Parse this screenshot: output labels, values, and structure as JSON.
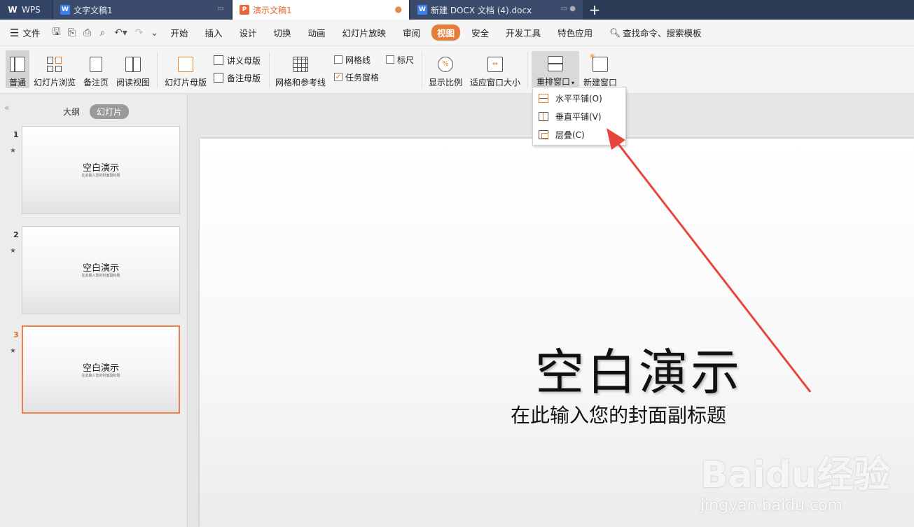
{
  "tabs": [
    {
      "label": "WPS",
      "icon": "wps-logo-icon"
    },
    {
      "label": "文字文稿1",
      "icon": "writer-doc-icon"
    },
    {
      "label": "演示文稿1",
      "icon": "presentation-doc-icon"
    },
    {
      "label": "新建 DOCX 文档 (4).docx",
      "icon": "writer-doc-icon"
    }
  ],
  "menu": {
    "file": "文件",
    "items": [
      "开始",
      "插入",
      "设计",
      "切换",
      "动画",
      "幻灯片放映",
      "审阅",
      "视图",
      "安全",
      "开发工具",
      "特色应用"
    ],
    "active": "视图",
    "search": "查找命令、搜索模板"
  },
  "ribbon": {
    "normal": "普通",
    "slide_sorter": "幻灯片浏览",
    "notes_page": "备注页",
    "reading_view": "阅读视图",
    "slide_master": "幻灯片母版",
    "handout_master": "讲义母版",
    "notes_master": "备注母版",
    "grid_guides": "网格和参考线",
    "gridlines": "网格线",
    "ruler": "标尺",
    "task_pane": "任务窗格",
    "zoom": "显示比例",
    "fit_window": "适应窗口大小",
    "arrange": "重排窗口",
    "new_window": "新建窗口"
  },
  "arrange_menu": [
    "水平平铺(O)",
    "垂直平铺(V)",
    "层叠(C)"
  ],
  "panel": {
    "outline": "大纲",
    "slides": "幻灯片"
  },
  "slides": [
    {
      "num": "1",
      "title": "空白演示",
      "subtitle": "在此输入您的封面副标题"
    },
    {
      "num": "2",
      "title": "空白演示",
      "subtitle": "在此输入您的封面副标题"
    },
    {
      "num": "3",
      "title": "空白演示",
      "subtitle": "在此输入您的封面副标题"
    }
  ],
  "current_slide": {
    "title": "空白演示",
    "subtitle": "在此输入您的封面副标题"
  },
  "watermark": {
    "brand": "Baidu经验",
    "url": "jingyan.baidu.com"
  },
  "colors": {
    "accent": "#e67e3b",
    "tabbar": "#2b3a55",
    "arrow": "#e8453c"
  }
}
